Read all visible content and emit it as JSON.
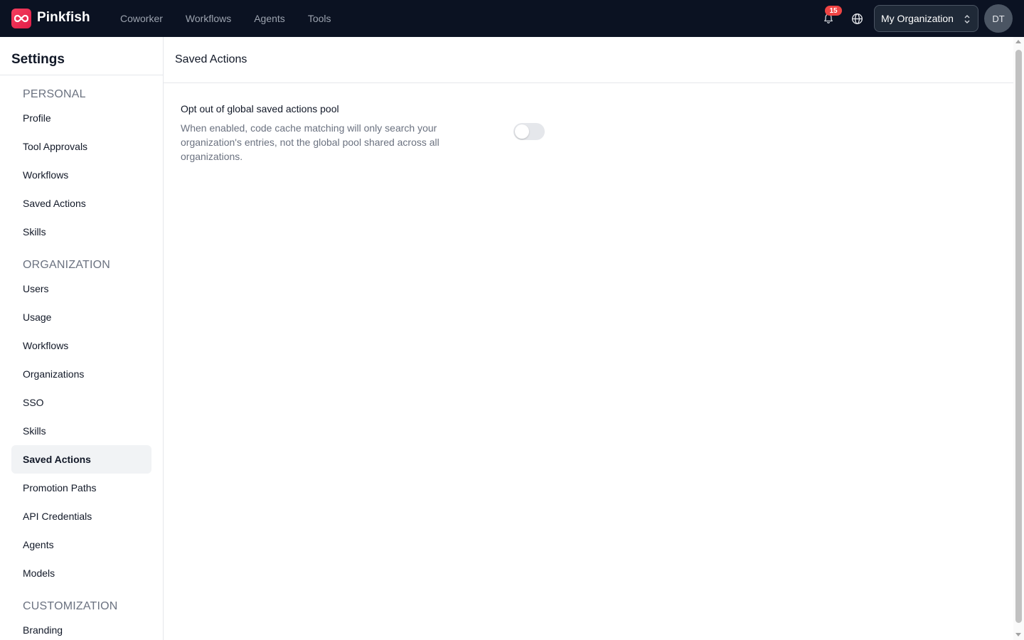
{
  "header": {
    "brand": "Pinkfish",
    "logo_icon": "infinity-icon",
    "nav": [
      {
        "label": "Coworker"
      },
      {
        "label": "Workflows"
      },
      {
        "label": "Agents"
      },
      {
        "label": "Tools"
      }
    ],
    "notifications_count": "15",
    "org_selector": {
      "label": "My Organization"
    },
    "avatar_initials": "DT"
  },
  "colors": {
    "topbar_bg": "#0b1222",
    "brand_accent": "#f43f5e",
    "badge": "#ef4444",
    "active_item_bg": "#f1f3f5",
    "toggle_off": "#e5e7eb"
  },
  "sidebar": {
    "title": "Settings",
    "sections": [
      {
        "label": "PERSONAL",
        "items": [
          {
            "label": "Profile"
          },
          {
            "label": "Tool Approvals"
          },
          {
            "label": "Workflows"
          },
          {
            "label": "Saved Actions"
          },
          {
            "label": "Skills"
          }
        ]
      },
      {
        "label": "ORGANIZATION",
        "items": [
          {
            "label": "Users"
          },
          {
            "label": "Usage"
          },
          {
            "label": "Workflows"
          },
          {
            "label": "Organizations"
          },
          {
            "label": "SSO"
          },
          {
            "label": "Skills"
          },
          {
            "label": "Saved Actions",
            "active": true
          },
          {
            "label": "Promotion Paths"
          },
          {
            "label": "API Credentials"
          },
          {
            "label": "Agents"
          },
          {
            "label": "Models"
          }
        ]
      },
      {
        "label": "CUSTOMIZATION",
        "items": [
          {
            "label": "Branding"
          }
        ]
      }
    ]
  },
  "main": {
    "title": "Saved Actions",
    "setting": {
      "title": "Opt out of global saved actions pool",
      "description": "When enabled, code cache matching will only search your organization's entries, not the global pool shared across all organizations.",
      "enabled": false
    }
  }
}
